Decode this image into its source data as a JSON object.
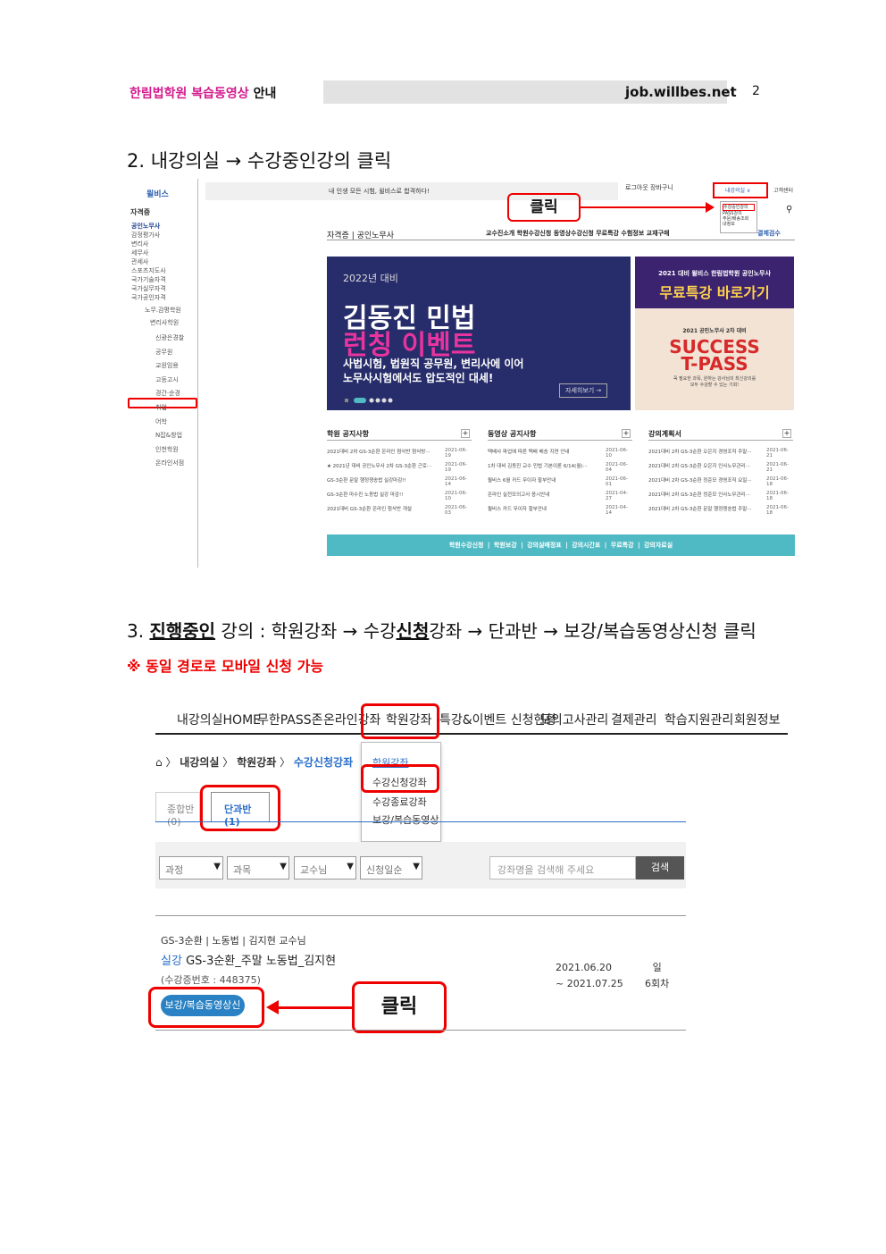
{
  "header": {
    "brand": "한림법학원 복습동영상",
    "suffix": "안내",
    "url": "job.willbes.net",
    "page": "2"
  },
  "step2": {
    "heading": "2. 내강의실 → 수강중인강의 클릭",
    "click_label": "클릭",
    "sidebar": {
      "logo": "윌비스",
      "category": "자격증",
      "items": [
        "공인노무사",
        "감정평가사",
        "변리사",
        "세무사",
        "관세사",
        "스포츠지도사",
        "국가기술자격",
        "국가실무자격",
        "국가공인자격"
      ],
      "academies": [
        "노무.감평학원",
        "변리사학원"
      ],
      "sections": [
        "신광은경찰",
        "공무원",
        "교원임용",
        "고등고시",
        "경간·순경",
        "취업",
        "어학",
        "N잡&창업",
        "인천학원",
        "온라인서점"
      ]
    },
    "topbar": "내 인생 모든 시험, 윌비스로 합격하다!",
    "toplinks": "로그아웃  장바구니",
    "my_lecture": "내강의실 ∨",
    "service": "고객센터",
    "dropdown": [
      "수강중인강의",
      "PASS강의",
      "주문/배송조회",
      "내정보"
    ],
    "crumb": "자격증 | 공인노무사",
    "menu": "교수진소개  학원수강신청  동영상수강신청  무료특강  수험정보  교재구매",
    "menu_right": "결제검수",
    "banner": {
      "year": "2022년 대비",
      "title1": "김동진 민법",
      "title2": "런칭 이벤트",
      "sub1": "사법시험, 법원직 공무원, 변리사에 이어",
      "sub2": "노무사시험에서도 압도적인 대세!",
      "more": "자세히보기 →"
    },
    "side_banner": {
      "a": "2021 대비 윌비스 한림법학원 공인노무사",
      "b": "무료특강 바로가기",
      "c": "2021 공인노무사 2차 대비",
      "d1": "SUCCESS",
      "d2": "T-PASS",
      "e1": "꼭 필요한 과목, 원하는 강사님의 최신강의를",
      "e2": "모두 수강할 수 있는 기회!"
    },
    "notices": [
      {
        "title": "학원 공지사항",
        "rows": [
          [
            "2021대비 2차 GS-3순환 온라인 첨삭반 첨삭방···",
            "2021-06-19"
          ],
          [
            "★ 2021년 대비 공인노무사 2차 GS-3순환 근로···",
            "2021-06-19"
          ],
          [
            "GS-3순환 문말 행정쟁송법 실강마감!!",
            "2021-06-14"
          ],
          [
            "GS-3순환 마수진 노동법 실강 마감!!",
            "2021-06-10"
          ],
          [
            "2021대비 GS-3순환 온라인 첨삭반 개설",
            "2021-06-03"
          ]
        ]
      },
      {
        "title": "동영상 공지사항",
        "rows": [
          [
            "택배사 파업에 따른 택배 배송 지연 안내",
            "2021-06-10"
          ],
          [
            "1차 대비 김동진 교수 민법 기본이론 6/14(월)···",
            "2021-06-04"
          ],
          [
            "윌비스 6월 카드 무이자 할부안내",
            "2021-06-01"
          ],
          [
            "온라인 실전모의고사 응시안내",
            "2021-04-27"
          ],
          [
            "윌비스 카드 무이자 할부안내",
            "2021-04-14"
          ]
        ]
      },
      {
        "title": "강의계획서",
        "rows": [
          [
            "2021대비 2차 GS-3순환 오은지 경영조직 주말···",
            "2021-06-21"
          ],
          [
            "2021대비 2차 GS-3순환 오은지 인사노무관리···",
            "2021-06-21"
          ],
          [
            "2021대비 2차 GS-3순환 정준모 경영조직 요일···",
            "2021-06-18"
          ],
          [
            "2021대비 2차 GS-3순환 정준모 인사노무관리···",
            "2021-06-18"
          ],
          [
            "2021대비 2차 GS-3순환 문말 행정쟁송법 주말···",
            "2021-06-18"
          ]
        ]
      }
    ],
    "bottom_bar": "학원수강신청  |  학원보강  |  강의실배정표  |  강의시간표  |  무료특강  |  강의자료실"
  },
  "step3": {
    "heading_pre": "3. ",
    "heading_u": "진행중인",
    "heading_mid": " 강의 : 학원강좌 → 수강",
    "heading_b": "신청",
    "heading_post": "강좌 → 단과반 → 보강/복습동영상신청 클릭",
    "note": "※ 동일 경로로 모바일 신청 가능",
    "nav": [
      "내강의실HOME",
      "무한PASS존",
      "온라인강좌",
      "학원강좌",
      "특강&이벤트 신청현황",
      "모의고사관리",
      "결제관리",
      "학습지원관리",
      "회원정보"
    ],
    "dropdown": [
      "학원강좌",
      "수강신청강좌",
      "수강종료강좌",
      "보강/복습동영상"
    ],
    "breadcrumb": [
      "내강의실",
      "학원강좌",
      "수강신청강좌"
    ],
    "tabs": [
      "종합반 (0)",
      "단과반 (1)"
    ],
    "filters": [
      "과정",
      "과목",
      "교수님",
      "신청일순"
    ],
    "search_placeholder": "강좌명을 검색해 주세요",
    "search_btn": "검색",
    "course": {
      "meta": "GS-3순환 | 노동법 | 김지현 교수님",
      "tag": "실강",
      "title": "GS-3순환_주말 노동법_김지현",
      "no": "(수강증번호 : 448375)",
      "date1": "2021.06.20",
      "date2": "~ 2021.07.25",
      "day": "일",
      "count": "6회차",
      "button": "보강/복습동영상신청 〉"
    },
    "click_label": "클릭"
  }
}
